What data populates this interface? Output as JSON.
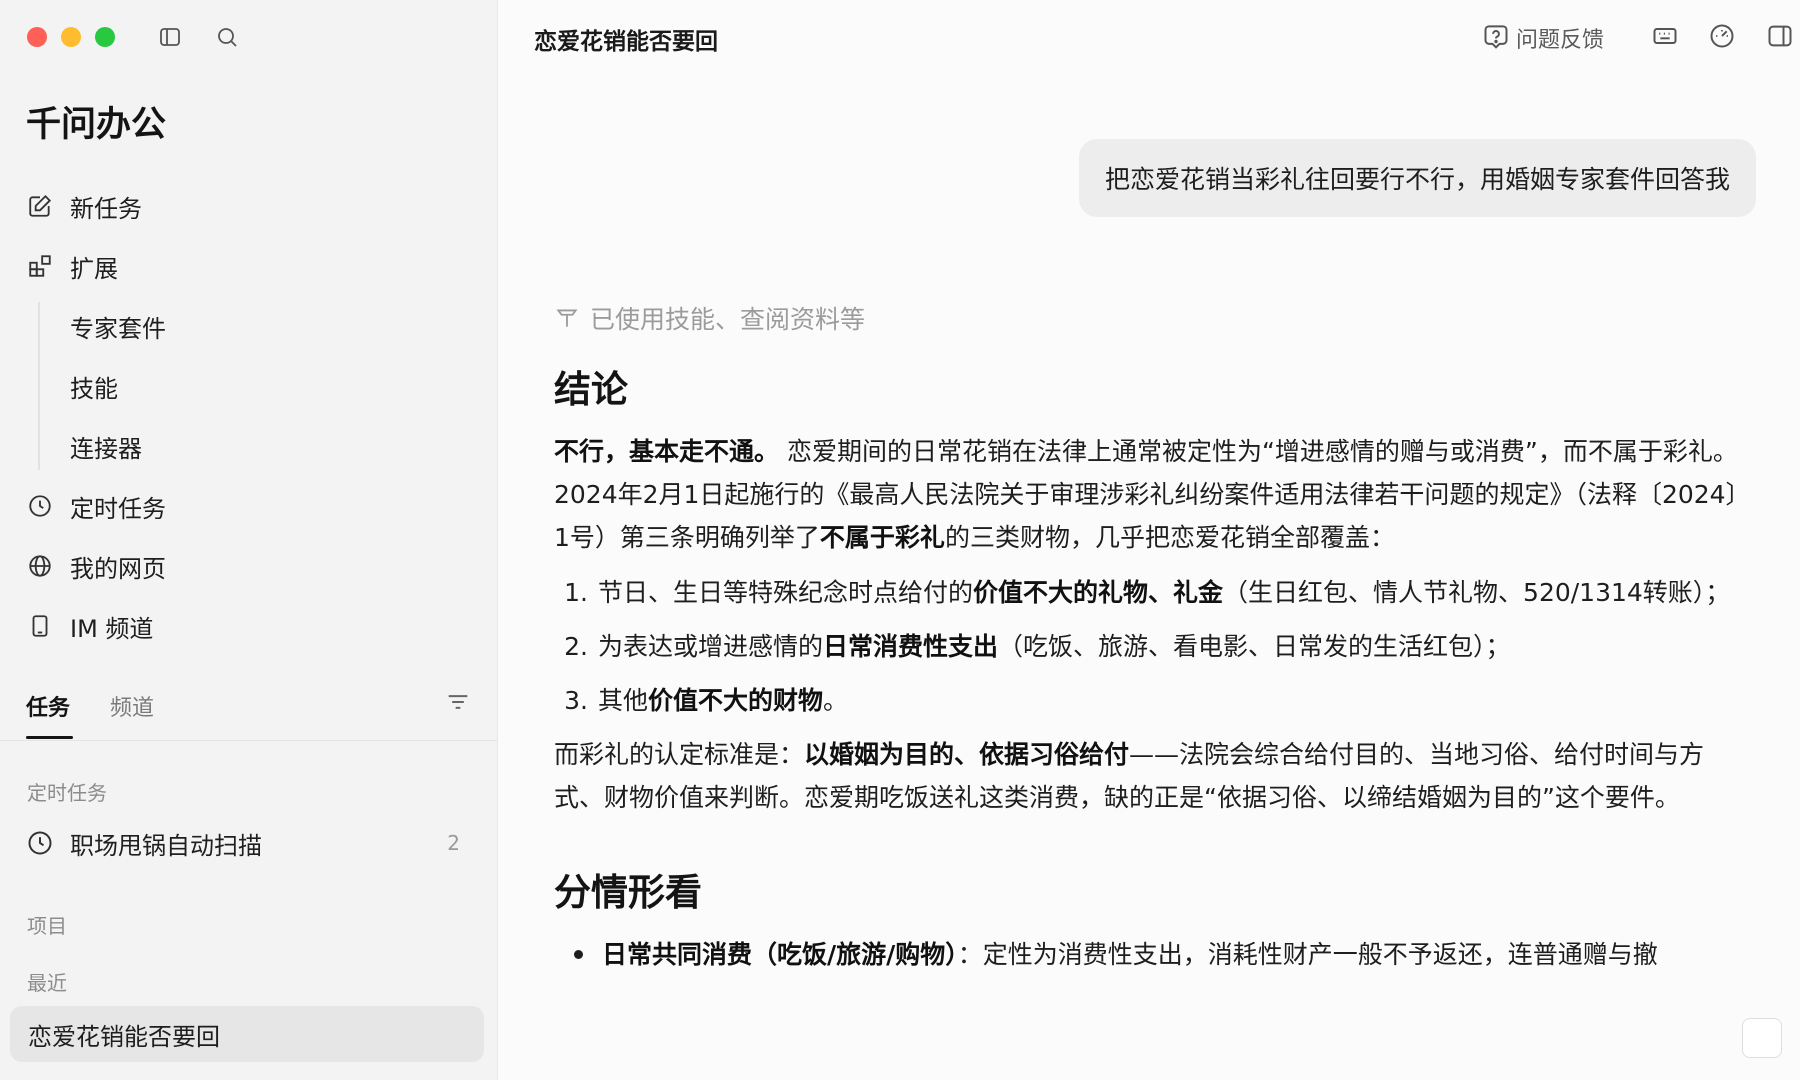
{
  "sidebar": {
    "brand": "千问办公",
    "nav": {
      "new_task": "新任务",
      "extensions": "扩展",
      "extension_items": [
        "专家套件",
        "技能",
        "连接器"
      ],
      "scheduled": "定时任务",
      "my_pages": "我的网页",
      "im_channel": "IM 频道"
    },
    "tabs": {
      "tasks": "任务",
      "channels": "频道"
    },
    "sections": {
      "scheduled_label": "定时任务",
      "projects_label": "项目",
      "recent_label": "最近"
    },
    "scheduled_task": {
      "label": "职场甩锅自动扫描",
      "count": "2"
    },
    "recent_item": "恋爱花销能否要回"
  },
  "main": {
    "title": "恋爱花销能否要回",
    "feedback": "问题反馈",
    "user_message": "把恋爱花销当彩礼往回要行不行，用婚姻专家套件回答我",
    "used_skills": "已使用技能、查阅资料等",
    "answer": {
      "h1": "结论",
      "p1": {
        "bold1": "不行，基本走不通。",
        "t1": " 恋爱期间的日常花销在法律上通常被定性为“增进感情的赠与或消费”，而不属于彩礼。2024年2月1日起施行的《最高人民法院关于审理涉彩礼纠纷案件适用法律若干问题的规定》（法释〔2024〕1号）第三条明确列举了",
        "bold2": "不属于彩礼",
        "t2": "的三类财物，几乎把恋爱花销全部覆盖："
      },
      "list": [
        {
          "num": "1.",
          "pre": "节日、生日等特殊纪念时点给付的",
          "bold": "价值不大的礼物、礼金",
          "post": "（生日红包、情人节礼物、520/1314转账）；"
        },
        {
          "num": "2.",
          "pre": "为表达或增进感情的",
          "bold": "日常消费性支出",
          "post": "（吃饭、旅游、看电影、日常发的生活红包）；"
        },
        {
          "num": "3.",
          "pre": "其他",
          "bold": "价值不大的财物",
          "post": "。"
        }
      ],
      "p2": {
        "t1": "而彩礼的认定标准是：",
        "bold": "以婚姻为目的、依据习俗给付",
        "t2": "——法院会综合给付目的、当地习俗、给付时间与方式、财物价值来判断。恋爱期吃饭送礼这类消费，缺的正是“依据习俗、以缔结婚姻为目的”这个要件。"
      },
      "h2": "分情形看",
      "bullet": {
        "bold": "日常共同消费（吃饭/旅游/购物）",
        "text": "：定性为消费性支出，消耗性财产一般不予返还，连普通赠与撤"
      }
    }
  }
}
